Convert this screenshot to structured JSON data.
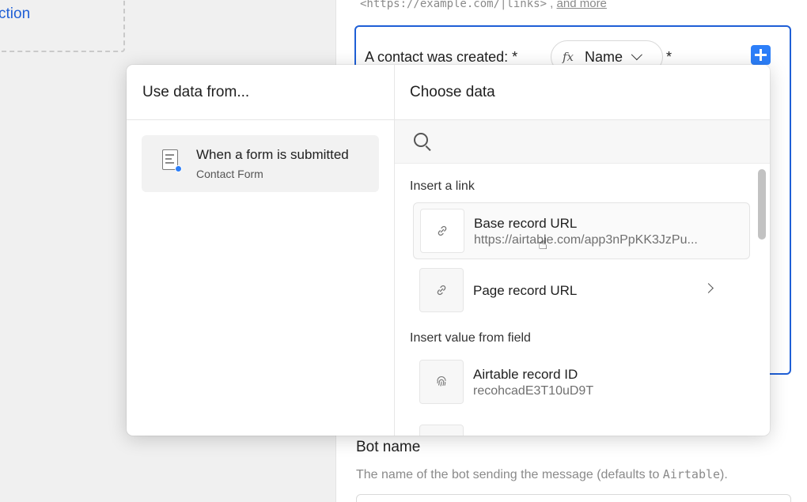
{
  "background": {
    "section_link": "ction",
    "hint_prefix": "<https://example.com/|links>",
    "hint_sep": " , ",
    "hint_more": "and more"
  },
  "message": {
    "text_before": "A contact was created:",
    "asterisk": "*",
    "chip_fx": "fx",
    "chip_label": "Name",
    "asterisk_after": "*"
  },
  "bot": {
    "title": "Bot name",
    "desc_prefix": "The name of the bot sending the message (defaults to ",
    "desc_mono": "Airtable",
    "desc_suffix": ")."
  },
  "popup": {
    "left_header": "Use data from...",
    "right_header": "Choose data",
    "sources": [
      {
        "title": "When a form is submitted",
        "subtitle": "Contact Form",
        "icon": "form-icon"
      }
    ],
    "search_placeholder": "",
    "groups": [
      {
        "label": "Insert a link",
        "items": [
          {
            "title": "Base record URL",
            "subtitle": "https://airtable.com/app3nPpKK3JzPu...",
            "icon": "link-icon"
          },
          {
            "title": "Page record URL",
            "subtitle": "",
            "icon": "link-icon",
            "has_chevron": true
          }
        ]
      },
      {
        "label": "Insert value from field",
        "items": [
          {
            "title": "Airtable record ID",
            "subtitle": "recohcadE3T10uD9T",
            "icon": "fingerprint-icon"
          }
        ]
      }
    ]
  },
  "colors": {
    "accent": "#2d7ff9",
    "focus_border": "#1f5fd6",
    "link": "#1f5fd6"
  }
}
